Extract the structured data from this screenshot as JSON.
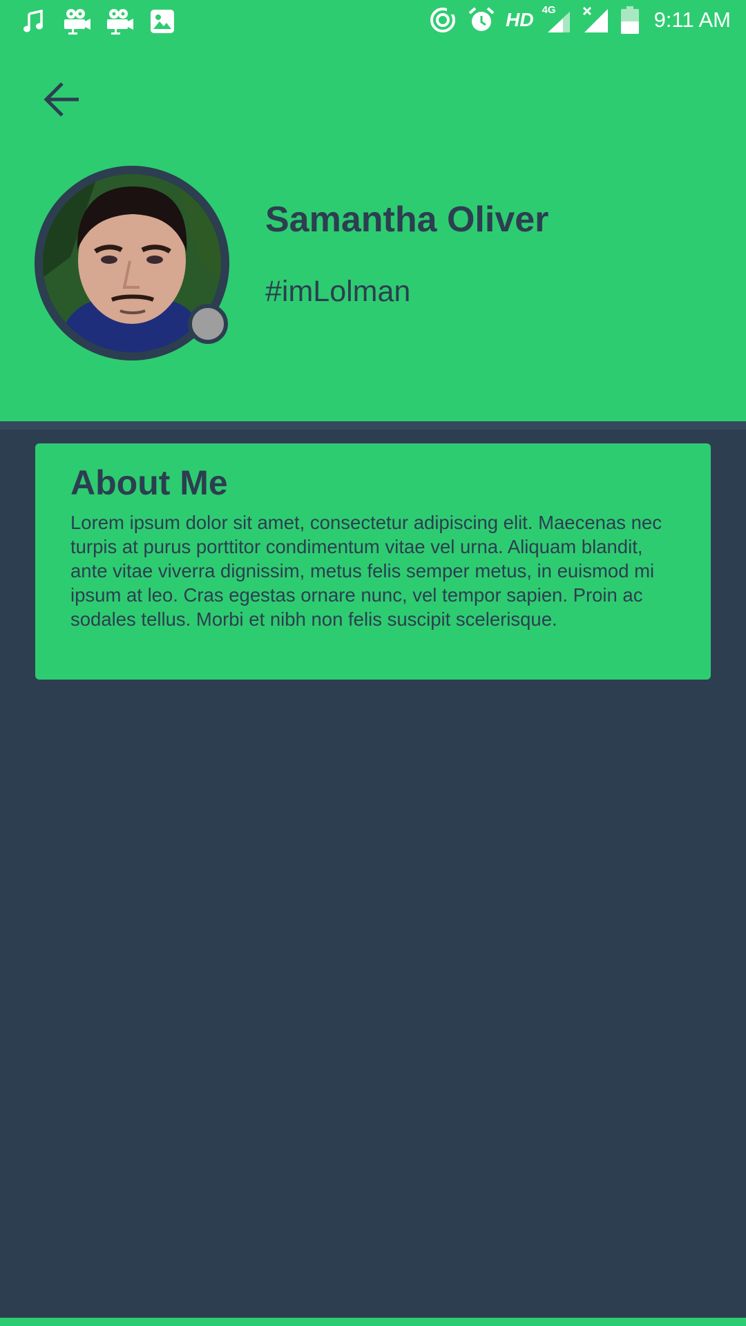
{
  "status_bar": {
    "left_icons": [
      "music-note-icon",
      "video-camera-icon",
      "video-camera-icon",
      "image-icon"
    ],
    "right_icons": [
      "data-saver-icon",
      "alarm-icon",
      "signal-4g-icon",
      "signal-no-sim-icon",
      "battery-icon"
    ],
    "hd_label": "HD",
    "network_label": "4G",
    "time": "9:11 AM"
  },
  "header": {
    "back_icon": "arrow-left-icon",
    "name": "Samantha Oliver",
    "handle": "#imLolman",
    "presence_status": "offline"
  },
  "about": {
    "title": "About Me",
    "body": "Lorem ipsum dolor sit amet, consectetur adipiscing elit. Maecenas nec turpis at purus porttitor condimentum vitae vel urna. Aliquam blandit, ante vitae viverra dignissim, metus felis semper metus, in euismod mi ipsum at leo. Cras egestas ornare nunc, vel tempor sapien. Proin ac sodales tellus. Morbi et nibh non felis suscipit scelerisque."
  },
  "colors": {
    "accent_green": "#2ecc71",
    "dark_navy": "#2c3e50",
    "divider": "#34495e",
    "status_dot": "#9e9e9e"
  }
}
